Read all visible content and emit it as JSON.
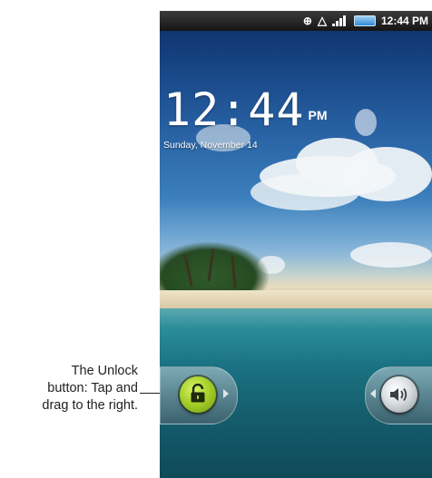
{
  "callout": {
    "line1": "The Unlock",
    "line2": "button: Tap and",
    "line3": "drag  to the right."
  },
  "status_bar": {
    "time": "12:44 PM",
    "icons": [
      "gps-icon",
      "alert-icon",
      "signal-icon",
      "battery-icon"
    ]
  },
  "lock_screen": {
    "clock_time": "12:44",
    "clock_ampm": "PM",
    "date": "Sunday, November 14"
  },
  "controls": {
    "unlock_icon": "unlock-icon",
    "sound_icon": "speaker-icon"
  },
  "colors": {
    "unlock_accent": "#a7d22a",
    "sky_top": "#0d2e64",
    "sea": "#1a7282"
  }
}
